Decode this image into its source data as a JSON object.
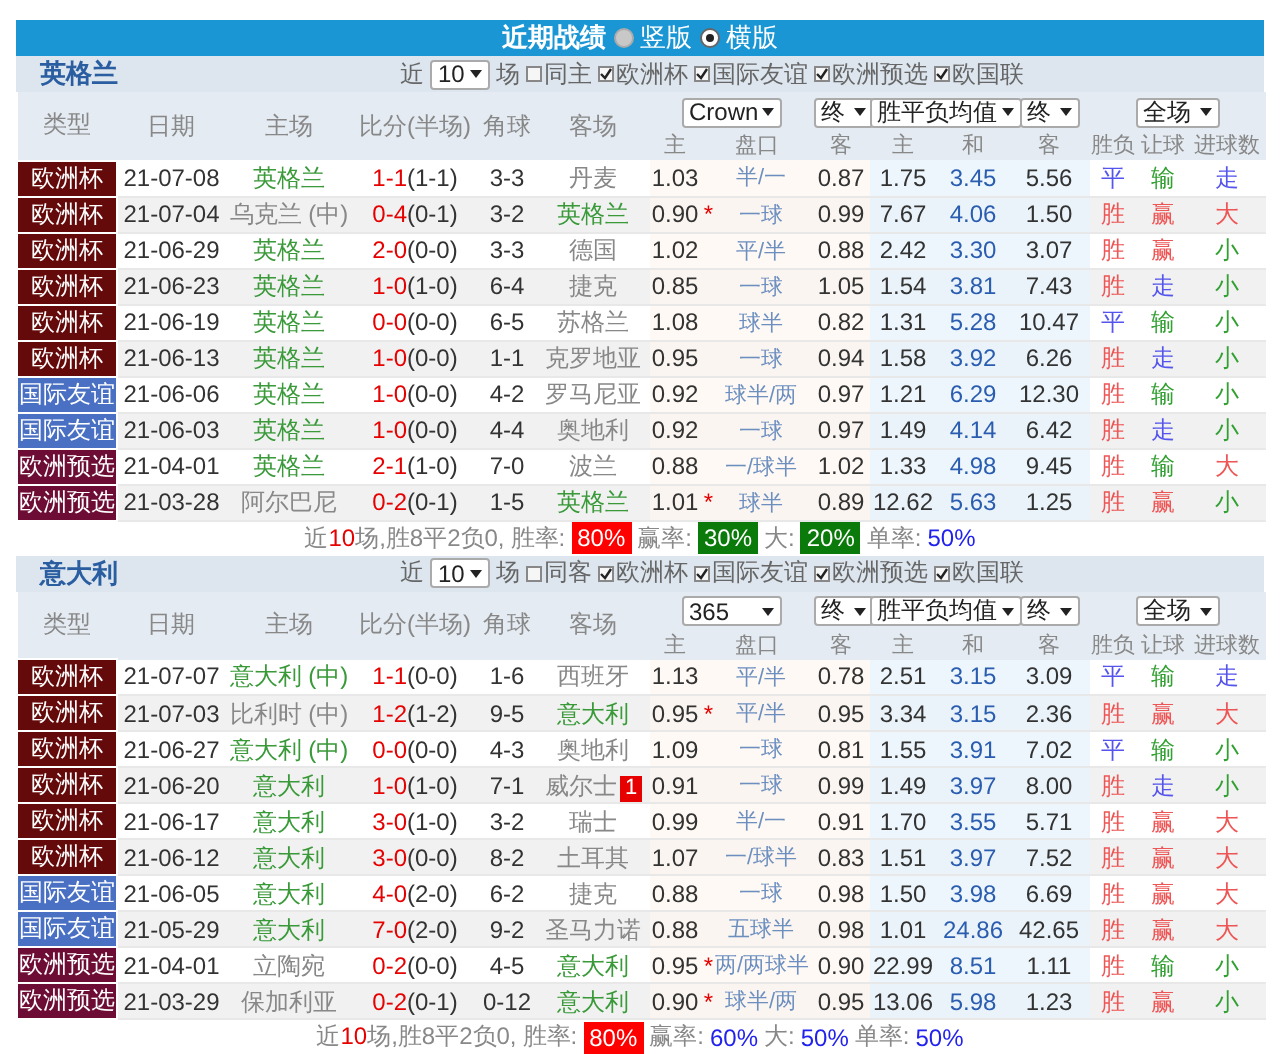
{
  "title_bar": {
    "title": "近期战绩",
    "views": [
      {
        "label": "竖版",
        "selected": false
      },
      {
        "label": "横版",
        "selected": true
      }
    ]
  },
  "sections": [
    {
      "team": "英格兰",
      "recent_prefix": "近",
      "match_count": "10",
      "recent_suffix": "场",
      "filters": [
        {
          "label": "同主",
          "checked": false
        },
        {
          "label": "欧洲杯",
          "checked": true
        },
        {
          "label": "国际友谊",
          "checked": true
        },
        {
          "label": "欧洲预选",
          "checked": true
        },
        {
          "label": "欧国联",
          "checked": true
        }
      ],
      "columns": [
        "类型",
        "日期",
        "主场",
        "比分(半场)",
        "角球",
        "客场"
      ],
      "selects": [
        "Crown",
        "终",
        "胜平负均值",
        "终",
        "全场"
      ],
      "subcolumns": [
        "主",
        "盘口",
        "客",
        "主",
        "和",
        "客",
        "胜负",
        "让球",
        "进球数"
      ],
      "rows": [
        {
          "type": "欧洲杯",
          "color": "#650a0a",
          "date": "21-07-08",
          "home": "英格兰",
          "home_highlight": true,
          "score": "1-1",
          "half": "(1-1)",
          "corners": "3-3",
          "away": "丹麦",
          "away_highlight": false,
          "ah_home": "1.03",
          "handicap": "半/一",
          "ah_away": "0.87",
          "eu_home": "1.75",
          "eu_draw": "3.45",
          "eu_away": "5.56",
          "results": [
            {
              "text": "平",
              "color": "#5555ee"
            },
            {
              "text": "输",
              "color": "#33a033"
            },
            {
              "text": "走",
              "color": "#5555ee"
            }
          ]
        },
        {
          "type": "欧洲杯",
          "color": "#650a0a",
          "date": "21-07-04",
          "home": "乌克兰 (中)",
          "home_highlight": false,
          "score": "0-4",
          "half": "(0-1)",
          "corners": "3-2",
          "away": "英格兰",
          "away_highlight": true,
          "ah_home": "0.90",
          "ah_mark": "*",
          "handicap": "一球",
          "ah_away": "0.99",
          "eu_home": "7.67",
          "eu_draw": "4.06",
          "eu_away": "1.50",
          "results": [
            {
              "text": "胜",
              "color": "#ee5555"
            },
            {
              "text": "赢",
              "color": "#ee5555"
            },
            {
              "text": "大",
              "color": "#ee5555"
            }
          ]
        },
        {
          "type": "欧洲杯",
          "color": "#650a0a",
          "date": "21-06-29",
          "home": "英格兰",
          "home_highlight": true,
          "score": "2-0",
          "half": "(0-0)",
          "corners": "3-3",
          "away": "德国",
          "away_highlight": false,
          "ah_home": "1.02",
          "handicap": "平/半",
          "ah_away": "0.88",
          "eu_home": "2.42",
          "eu_draw": "3.30",
          "eu_away": "3.07",
          "results": [
            {
              "text": "胜",
              "color": "#ee5555"
            },
            {
              "text": "赢",
              "color": "#ee5555"
            },
            {
              "text": "小",
              "color": "#33a033"
            }
          ]
        },
        {
          "type": "欧洲杯",
          "color": "#650a0a",
          "date": "21-06-23",
          "home": "英格兰",
          "home_highlight": true,
          "score": "1-0",
          "half": "(1-0)",
          "corners": "6-4",
          "away": "捷克",
          "away_highlight": false,
          "ah_home": "0.85",
          "handicap": "一球",
          "ah_away": "1.05",
          "eu_home": "1.54",
          "eu_draw": "3.81",
          "eu_away": "7.43",
          "results": [
            {
              "text": "胜",
              "color": "#ee5555"
            },
            {
              "text": "走",
              "color": "#5555ee"
            },
            {
              "text": "小",
              "color": "#33a033"
            }
          ]
        },
        {
          "type": "欧洲杯",
          "color": "#650a0a",
          "date": "21-06-19",
          "home": "英格兰",
          "home_highlight": true,
          "score": "0-0",
          "half": "(0-0)",
          "corners": "6-5",
          "away": "苏格兰",
          "away_highlight": false,
          "ah_home": "1.08",
          "handicap": "球半",
          "ah_away": "0.82",
          "eu_home": "1.31",
          "eu_draw": "5.28",
          "eu_away": "10.47",
          "results": [
            {
              "text": "平",
              "color": "#5555ee"
            },
            {
              "text": "输",
              "color": "#33a033"
            },
            {
              "text": "小",
              "color": "#33a033"
            }
          ]
        },
        {
          "type": "欧洲杯",
          "color": "#650a0a",
          "date": "21-06-13",
          "home": "英格兰",
          "home_highlight": true,
          "score": "1-0",
          "half": "(0-0)",
          "corners": "1-1",
          "away": "克罗地亚",
          "away_highlight": false,
          "ah_home": "0.95",
          "handicap": "一球",
          "ah_away": "0.94",
          "eu_home": "1.58",
          "eu_draw": "3.92",
          "eu_away": "6.26",
          "results": [
            {
              "text": "胜",
              "color": "#ee5555"
            },
            {
              "text": "走",
              "color": "#5555ee"
            },
            {
              "text": "小",
              "color": "#33a033"
            }
          ]
        },
        {
          "type": "国际友谊",
          "color": "#4a70c4",
          "date": "21-06-06",
          "home": "英格兰",
          "home_highlight": true,
          "score": "1-0",
          "half": "(0-0)",
          "corners": "4-2",
          "away": "罗马尼亚",
          "away_highlight": false,
          "ah_home": "0.92",
          "handicap": "球半/两",
          "ah_away": "0.97",
          "eu_home": "1.21",
          "eu_draw": "6.29",
          "eu_away": "12.30",
          "results": [
            {
              "text": "胜",
              "color": "#ee5555"
            },
            {
              "text": "输",
              "color": "#33a033"
            },
            {
              "text": "小",
              "color": "#33a033"
            }
          ]
        },
        {
          "type": "国际友谊",
          "color": "#4a70c4",
          "date": "21-06-03",
          "home": "英格兰",
          "home_highlight": true,
          "score": "1-0",
          "half": "(0-0)",
          "corners": "4-4",
          "away": "奥地利",
          "away_highlight": false,
          "ah_home": "0.92",
          "handicap": "一球",
          "ah_away": "0.97",
          "eu_home": "1.49",
          "eu_draw": "4.14",
          "eu_away": "6.42",
          "results": [
            {
              "text": "胜",
              "color": "#ee5555"
            },
            {
              "text": "走",
              "color": "#5555ee"
            },
            {
              "text": "小",
              "color": "#33a033"
            }
          ]
        },
        {
          "type": "欧洲预选",
          "color": "#6d0c34",
          "date": "21-04-01",
          "home": "英格兰",
          "home_highlight": true,
          "score": "2-1",
          "half": "(1-0)",
          "corners": "7-0",
          "away": "波兰",
          "away_highlight": false,
          "ah_home": "0.88",
          "handicap": "一/球半",
          "ah_away": "1.02",
          "eu_home": "1.33",
          "eu_draw": "4.98",
          "eu_away": "9.45",
          "results": [
            {
              "text": "胜",
              "color": "#ee5555"
            },
            {
              "text": "输",
              "color": "#33a033"
            },
            {
              "text": "大",
              "color": "#ee5555"
            }
          ]
        },
        {
          "type": "欧洲预选",
          "color": "#6d0c34",
          "date": "21-03-28",
          "home": "阿尔巴尼",
          "home_highlight": false,
          "score": "0-2",
          "half": "(0-1)",
          "corners": "1-5",
          "away": "英格兰",
          "away_highlight": true,
          "ah_home": "1.01",
          "ah_mark": "*",
          "handicap": "球半",
          "ah_away": "0.89",
          "eu_home": "12.62",
          "eu_draw": "5.63",
          "eu_away": "1.25",
          "results": [
            {
              "text": "胜",
              "color": "#ee5555"
            },
            {
              "text": "赢",
              "color": "#ee5555"
            },
            {
              "text": "小",
              "color": "#33a033"
            }
          ]
        }
      ],
      "summary": {
        "prefix": "近",
        "count": "10",
        "rest": "场,胜8平2负0,",
        "stats": [
          {
            "label": "胜率:",
            "value": "80%",
            "kind": "red"
          },
          {
            "label": "赢率:",
            "value": "30%",
            "kind": "green"
          },
          {
            "label": "大:",
            "value": "20%",
            "kind": "green"
          },
          {
            "label": "单率:",
            "value": "50%",
            "kind": "plain"
          }
        ]
      }
    },
    {
      "team": "意大利",
      "recent_prefix": "近",
      "match_count": "10",
      "recent_suffix": "场",
      "filters": [
        {
          "label": "同客",
          "checked": false
        },
        {
          "label": "欧洲杯",
          "checked": true
        },
        {
          "label": "国际友谊",
          "checked": true
        },
        {
          "label": "欧洲预选",
          "checked": true
        },
        {
          "label": "欧国联",
          "checked": true
        }
      ],
      "columns": [
        "类型",
        "日期",
        "主场",
        "比分(半场)",
        "角球",
        "客场"
      ],
      "selects": [
        "365",
        "终",
        "胜平负均值",
        "终",
        "全场"
      ],
      "subcolumns": [
        "主",
        "盘口",
        "客",
        "主",
        "和",
        "客",
        "胜负",
        "让球",
        "进球数"
      ],
      "rows": [
        {
          "type": "欧洲杯",
          "color": "#650a0a",
          "date": "21-07-07",
          "home": "意大利 (中)",
          "home_highlight": true,
          "score": "1-1",
          "half": "(0-0)",
          "corners": "1-6",
          "away": "西班牙",
          "away_highlight": false,
          "ah_home": "1.13",
          "handicap": "平/半",
          "ah_away": "0.78",
          "eu_home": "2.51",
          "eu_draw": "3.15",
          "eu_away": "3.09",
          "results": [
            {
              "text": "平",
              "color": "#5555ee"
            },
            {
              "text": "输",
              "color": "#33a033"
            },
            {
              "text": "走",
              "color": "#5555ee"
            }
          ]
        },
        {
          "type": "欧洲杯",
          "color": "#650a0a",
          "date": "21-07-03",
          "home": "比利时 (中)",
          "home_highlight": false,
          "score": "1-2",
          "half": "(1-2)",
          "corners": "9-5",
          "away": "意大利",
          "away_highlight": true,
          "ah_home": "0.95",
          "ah_mark": "*",
          "handicap": "平/半",
          "ah_away": "0.95",
          "eu_home": "3.34",
          "eu_draw": "3.15",
          "eu_away": "2.36",
          "results": [
            {
              "text": "胜",
              "color": "#ee5555"
            },
            {
              "text": "赢",
              "color": "#ee5555"
            },
            {
              "text": "大",
              "color": "#ee5555"
            }
          ]
        },
        {
          "type": "欧洲杯",
          "color": "#650a0a",
          "date": "21-06-27",
          "home": "意大利 (中)",
          "home_highlight": true,
          "score": "0-0",
          "half": "(0-0)",
          "corners": "4-3",
          "away": "奥地利",
          "away_highlight": false,
          "ah_home": "1.09",
          "handicap": "一球",
          "ah_away": "0.81",
          "eu_home": "1.55",
          "eu_draw": "3.91",
          "eu_away": "7.02",
          "results": [
            {
              "text": "平",
              "color": "#5555ee"
            },
            {
              "text": "输",
              "color": "#33a033"
            },
            {
              "text": "小",
              "color": "#33a033"
            }
          ]
        },
        {
          "type": "欧洲杯",
          "color": "#650a0a",
          "date": "21-06-20",
          "home": "意大利",
          "home_highlight": true,
          "score": "1-0",
          "half": "(1-0)",
          "corners": "7-1",
          "away": "威尔士",
          "away_highlight": false,
          "red_cards": "1",
          "ah_home": "0.91",
          "handicap": "一球",
          "ah_away": "0.99",
          "eu_home": "1.49",
          "eu_draw": "3.97",
          "eu_away": "8.00",
          "results": [
            {
              "text": "胜",
              "color": "#ee5555"
            },
            {
              "text": "走",
              "color": "#5555ee"
            },
            {
              "text": "小",
              "color": "#33a033"
            }
          ]
        },
        {
          "type": "欧洲杯",
          "color": "#650a0a",
          "date": "21-06-17",
          "home": "意大利",
          "home_highlight": true,
          "score": "3-0",
          "half": "(1-0)",
          "corners": "3-2",
          "away": "瑞士",
          "away_highlight": false,
          "ah_home": "0.99",
          "handicap": "半/一",
          "ah_away": "0.91",
          "eu_home": "1.70",
          "eu_draw": "3.55",
          "eu_away": "5.71",
          "results": [
            {
              "text": "胜",
              "color": "#ee5555"
            },
            {
              "text": "赢",
              "color": "#ee5555"
            },
            {
              "text": "大",
              "color": "#ee5555"
            }
          ]
        },
        {
          "type": "欧洲杯",
          "color": "#650a0a",
          "date": "21-06-12",
          "home": "意大利",
          "home_highlight": true,
          "score": "3-0",
          "half": "(0-0)",
          "corners": "8-2",
          "away": "土耳其",
          "away_highlight": false,
          "ah_home": "1.07",
          "handicap": "一/球半",
          "ah_away": "0.83",
          "eu_home": "1.51",
          "eu_draw": "3.97",
          "eu_away": "7.52",
          "results": [
            {
              "text": "胜",
              "color": "#ee5555"
            },
            {
              "text": "赢",
              "color": "#ee5555"
            },
            {
              "text": "大",
              "color": "#ee5555"
            }
          ]
        },
        {
          "type": "国际友谊",
          "color": "#4a70c4",
          "date": "21-06-05",
          "home": "意大利",
          "home_highlight": true,
          "score": "4-0",
          "half": "(2-0)",
          "corners": "6-2",
          "away": "捷克",
          "away_highlight": false,
          "ah_home": "0.88",
          "handicap": "一球",
          "ah_away": "0.98",
          "eu_home": "1.50",
          "eu_draw": "3.98",
          "eu_away": "6.69",
          "results": [
            {
              "text": "胜",
              "color": "#ee5555"
            },
            {
              "text": "赢",
              "color": "#ee5555"
            },
            {
              "text": "大",
              "color": "#ee5555"
            }
          ]
        },
        {
          "type": "国际友谊",
          "color": "#4a70c4",
          "date": "21-05-29",
          "home": "意大利",
          "home_highlight": true,
          "score": "7-0",
          "half": "(2-0)",
          "corners": "9-2",
          "away": "圣马力诺",
          "away_highlight": false,
          "ah_home": "0.88",
          "handicap": "五球半",
          "ah_away": "0.98",
          "eu_home": "1.01",
          "eu_draw": "24.86",
          "eu_away": "42.65",
          "results": [
            {
              "text": "胜",
              "color": "#ee5555"
            },
            {
              "text": "赢",
              "color": "#ee5555"
            },
            {
              "text": "大",
              "color": "#ee5555"
            }
          ]
        },
        {
          "type": "欧洲预选",
          "color": "#6d0c34",
          "date": "21-04-01",
          "home": "立陶宛",
          "home_highlight": false,
          "score": "0-2",
          "half": "(0-0)",
          "corners": "4-5",
          "away": "意大利",
          "away_highlight": true,
          "ah_home": "0.95",
          "ah_mark": "*",
          "handicap": "两/两球半",
          "ah_away": "0.90",
          "eu_home": "22.99",
          "eu_draw": "8.51",
          "eu_away": "1.11",
          "results": [
            {
              "text": "胜",
              "color": "#ee5555"
            },
            {
              "text": "输",
              "color": "#33a033"
            },
            {
              "text": "小",
              "color": "#33a033"
            }
          ]
        },
        {
          "type": "欧洲预选",
          "color": "#6d0c34",
          "date": "21-03-29",
          "home": "保加利亚",
          "home_highlight": false,
          "score": "0-2",
          "half": "(0-1)",
          "corners": "0-12",
          "away": "意大利",
          "away_highlight": true,
          "ah_home": "0.90",
          "ah_mark": "*",
          "handicap": "球半/两",
          "ah_away": "0.95",
          "eu_home": "13.06",
          "eu_draw": "5.98",
          "eu_away": "1.23",
          "results": [
            {
              "text": "胜",
              "color": "#ee5555"
            },
            {
              "text": "赢",
              "color": "#ee5555"
            },
            {
              "text": "小",
              "color": "#33a033"
            }
          ]
        }
      ],
      "summary": {
        "prefix": "近",
        "count": "10",
        "rest": "场,胜8平2负0,",
        "stats": [
          {
            "label": "胜率:",
            "value": "80%",
            "kind": "red"
          },
          {
            "label": "赢率:",
            "value": "60%",
            "kind": "plain"
          },
          {
            "label": "大:",
            "value": "50%",
            "kind": "plain"
          },
          {
            "label": "单率:",
            "value": "50%",
            "kind": "plain"
          }
        ]
      }
    }
  ]
}
